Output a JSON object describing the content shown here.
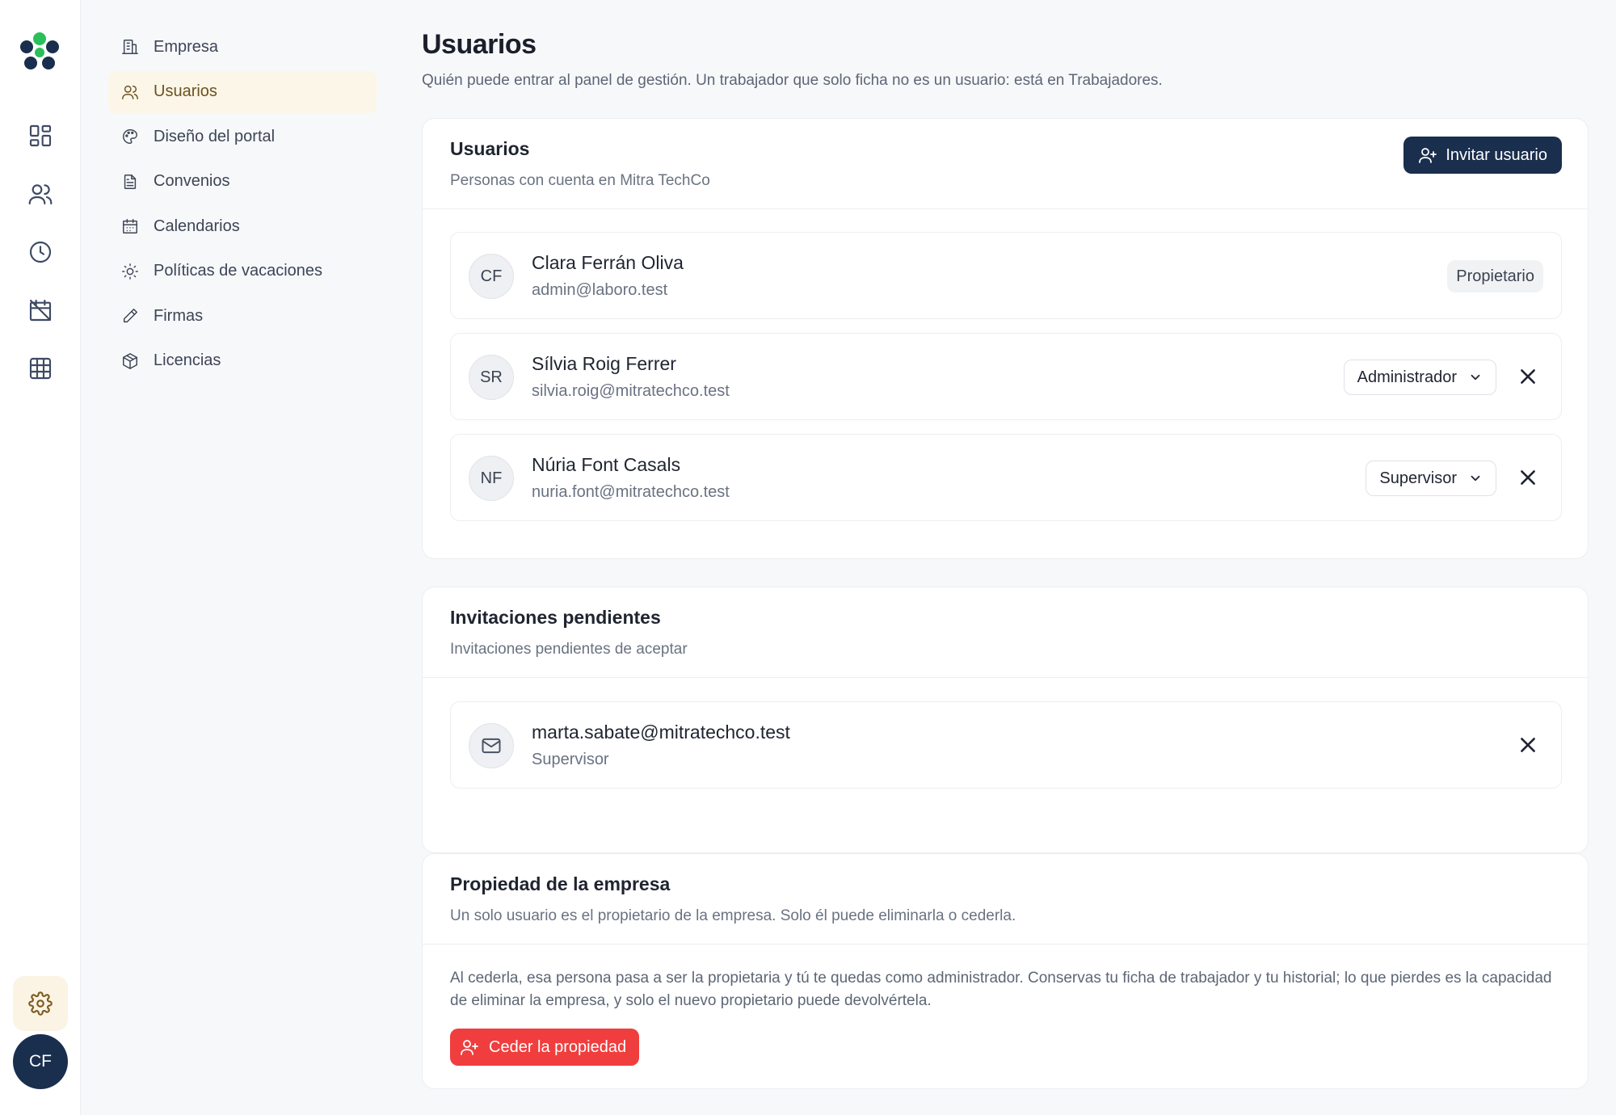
{
  "nav": {
    "items": [
      {
        "label": "Empresa",
        "icon": "building-icon"
      },
      {
        "label": "Usuarios",
        "icon": "users-icon",
        "active": true
      },
      {
        "label": "Diseño del portal",
        "icon": "palette-icon"
      },
      {
        "label": "Convenios",
        "icon": "document-icon"
      },
      {
        "label": "Calendarios",
        "icon": "calendar-icon"
      },
      {
        "label": "Políticas de vacaciones",
        "icon": "sun-icon"
      },
      {
        "label": "Firmas",
        "icon": "pen-icon"
      },
      {
        "label": "Licencias",
        "icon": "package-icon"
      }
    ]
  },
  "rail": {
    "icons": [
      "dashboard-icon",
      "people-icon",
      "clock-icon",
      "calendar-off-icon",
      "table-icon",
      "settings-icon"
    ],
    "avatar_initials": "CF"
  },
  "page": {
    "title": "Usuarios",
    "subtitle": "Quién puede entrar al panel de gestión. Un trabajador que solo ficha no es un usuario: está en Trabajadores."
  },
  "users_card": {
    "title": "Usuarios",
    "description": "Personas con cuenta en Mitra TechCo",
    "invite_label": "Invitar usuario",
    "users": [
      {
        "initials": "CF",
        "name": "Clara Ferrán Oliva",
        "email": "admin@laboro.test",
        "badge": "Propietario"
      },
      {
        "initials": "SR",
        "name": "Sílvia Roig Ferrer",
        "email": "silvia.roig@mitratechco.test",
        "role": "Administrador"
      },
      {
        "initials": "NF",
        "name": "Núria Font Casals",
        "email": "nuria.font@mitratechco.test",
        "role": "Supervisor"
      }
    ]
  },
  "invites_card": {
    "title": "Invitaciones pendientes",
    "description": "Invitaciones pendientes de aceptar",
    "invites": [
      {
        "email": "marta.sabate@mitratechco.test",
        "role": "Supervisor"
      }
    ]
  },
  "ownership_card": {
    "title": "Propiedad de la empresa",
    "description": "Un solo usuario es el propietario de la empresa. Solo él puede eliminarla o cederla.",
    "body": "Al cederla, esa persona pasa a ser la propietaria y tú te quedas como administrador. Conservas tu ficha de trabajador y tu historial; lo que pierdes es la capacidad de eliminar la empresa, y solo el nuevo propietario puede devolvértela.",
    "button_label": "Ceder la propiedad"
  },
  "colors": {
    "primary": "#1a2e4d",
    "danger": "#f03e3e",
    "active_nav_bg": "#fbf6e7",
    "logo_green": "#2bbf5a"
  }
}
